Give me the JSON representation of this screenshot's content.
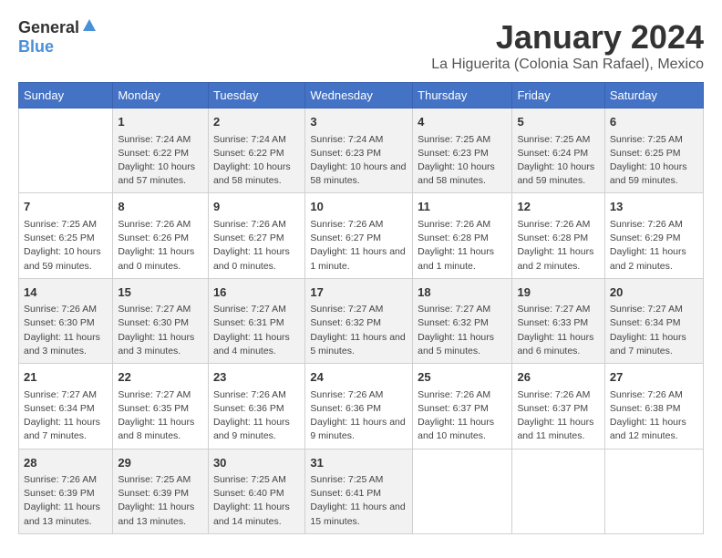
{
  "logo": {
    "general": "General",
    "blue": "Blue"
  },
  "title": "January 2024",
  "location": "La Higuerita (Colonia San Rafael), Mexico",
  "days_of_week": [
    "Sunday",
    "Monday",
    "Tuesday",
    "Wednesday",
    "Thursday",
    "Friday",
    "Saturday"
  ],
  "weeks": [
    [
      {
        "day": "",
        "sunrise": "",
        "sunset": "",
        "daylight": ""
      },
      {
        "day": "1",
        "sunrise": "Sunrise: 7:24 AM",
        "sunset": "Sunset: 6:22 PM",
        "daylight": "Daylight: 10 hours and 57 minutes."
      },
      {
        "day": "2",
        "sunrise": "Sunrise: 7:24 AM",
        "sunset": "Sunset: 6:22 PM",
        "daylight": "Daylight: 10 hours and 58 minutes."
      },
      {
        "day": "3",
        "sunrise": "Sunrise: 7:24 AM",
        "sunset": "Sunset: 6:23 PM",
        "daylight": "Daylight: 10 hours and 58 minutes."
      },
      {
        "day": "4",
        "sunrise": "Sunrise: 7:25 AM",
        "sunset": "Sunset: 6:23 PM",
        "daylight": "Daylight: 10 hours and 58 minutes."
      },
      {
        "day": "5",
        "sunrise": "Sunrise: 7:25 AM",
        "sunset": "Sunset: 6:24 PM",
        "daylight": "Daylight: 10 hours and 59 minutes."
      },
      {
        "day": "6",
        "sunrise": "Sunrise: 7:25 AM",
        "sunset": "Sunset: 6:25 PM",
        "daylight": "Daylight: 10 hours and 59 minutes."
      }
    ],
    [
      {
        "day": "7",
        "sunrise": "Sunrise: 7:25 AM",
        "sunset": "Sunset: 6:25 PM",
        "daylight": "Daylight: 10 hours and 59 minutes."
      },
      {
        "day": "8",
        "sunrise": "Sunrise: 7:26 AM",
        "sunset": "Sunset: 6:26 PM",
        "daylight": "Daylight: 11 hours and 0 minutes."
      },
      {
        "day": "9",
        "sunrise": "Sunrise: 7:26 AM",
        "sunset": "Sunset: 6:27 PM",
        "daylight": "Daylight: 11 hours and 0 minutes."
      },
      {
        "day": "10",
        "sunrise": "Sunrise: 7:26 AM",
        "sunset": "Sunset: 6:27 PM",
        "daylight": "Daylight: 11 hours and 1 minute."
      },
      {
        "day": "11",
        "sunrise": "Sunrise: 7:26 AM",
        "sunset": "Sunset: 6:28 PM",
        "daylight": "Daylight: 11 hours and 1 minute."
      },
      {
        "day": "12",
        "sunrise": "Sunrise: 7:26 AM",
        "sunset": "Sunset: 6:28 PM",
        "daylight": "Daylight: 11 hours and 2 minutes."
      },
      {
        "day": "13",
        "sunrise": "Sunrise: 7:26 AM",
        "sunset": "Sunset: 6:29 PM",
        "daylight": "Daylight: 11 hours and 2 minutes."
      }
    ],
    [
      {
        "day": "14",
        "sunrise": "Sunrise: 7:26 AM",
        "sunset": "Sunset: 6:30 PM",
        "daylight": "Daylight: 11 hours and 3 minutes."
      },
      {
        "day": "15",
        "sunrise": "Sunrise: 7:27 AM",
        "sunset": "Sunset: 6:30 PM",
        "daylight": "Daylight: 11 hours and 3 minutes."
      },
      {
        "day": "16",
        "sunrise": "Sunrise: 7:27 AM",
        "sunset": "Sunset: 6:31 PM",
        "daylight": "Daylight: 11 hours and 4 minutes."
      },
      {
        "day": "17",
        "sunrise": "Sunrise: 7:27 AM",
        "sunset": "Sunset: 6:32 PM",
        "daylight": "Daylight: 11 hours and 5 minutes."
      },
      {
        "day": "18",
        "sunrise": "Sunrise: 7:27 AM",
        "sunset": "Sunset: 6:32 PM",
        "daylight": "Daylight: 11 hours and 5 minutes."
      },
      {
        "day": "19",
        "sunrise": "Sunrise: 7:27 AM",
        "sunset": "Sunset: 6:33 PM",
        "daylight": "Daylight: 11 hours and 6 minutes."
      },
      {
        "day": "20",
        "sunrise": "Sunrise: 7:27 AM",
        "sunset": "Sunset: 6:34 PM",
        "daylight": "Daylight: 11 hours and 7 minutes."
      }
    ],
    [
      {
        "day": "21",
        "sunrise": "Sunrise: 7:27 AM",
        "sunset": "Sunset: 6:34 PM",
        "daylight": "Daylight: 11 hours and 7 minutes."
      },
      {
        "day": "22",
        "sunrise": "Sunrise: 7:27 AM",
        "sunset": "Sunset: 6:35 PM",
        "daylight": "Daylight: 11 hours and 8 minutes."
      },
      {
        "day": "23",
        "sunrise": "Sunrise: 7:26 AM",
        "sunset": "Sunset: 6:36 PM",
        "daylight": "Daylight: 11 hours and 9 minutes."
      },
      {
        "day": "24",
        "sunrise": "Sunrise: 7:26 AM",
        "sunset": "Sunset: 6:36 PM",
        "daylight": "Daylight: 11 hours and 9 minutes."
      },
      {
        "day": "25",
        "sunrise": "Sunrise: 7:26 AM",
        "sunset": "Sunset: 6:37 PM",
        "daylight": "Daylight: 11 hours and 10 minutes."
      },
      {
        "day": "26",
        "sunrise": "Sunrise: 7:26 AM",
        "sunset": "Sunset: 6:37 PM",
        "daylight": "Daylight: 11 hours and 11 minutes."
      },
      {
        "day": "27",
        "sunrise": "Sunrise: 7:26 AM",
        "sunset": "Sunset: 6:38 PM",
        "daylight": "Daylight: 11 hours and 12 minutes."
      }
    ],
    [
      {
        "day": "28",
        "sunrise": "Sunrise: 7:26 AM",
        "sunset": "Sunset: 6:39 PM",
        "daylight": "Daylight: 11 hours and 13 minutes."
      },
      {
        "day": "29",
        "sunrise": "Sunrise: 7:25 AM",
        "sunset": "Sunset: 6:39 PM",
        "daylight": "Daylight: 11 hours and 13 minutes."
      },
      {
        "day": "30",
        "sunrise": "Sunrise: 7:25 AM",
        "sunset": "Sunset: 6:40 PM",
        "daylight": "Daylight: 11 hours and 14 minutes."
      },
      {
        "day": "31",
        "sunrise": "Sunrise: 7:25 AM",
        "sunset": "Sunset: 6:41 PM",
        "daylight": "Daylight: 11 hours and 15 minutes."
      },
      {
        "day": "",
        "sunrise": "",
        "sunset": "",
        "daylight": ""
      },
      {
        "day": "",
        "sunrise": "",
        "sunset": "",
        "daylight": ""
      },
      {
        "day": "",
        "sunrise": "",
        "sunset": "",
        "daylight": ""
      }
    ]
  ]
}
